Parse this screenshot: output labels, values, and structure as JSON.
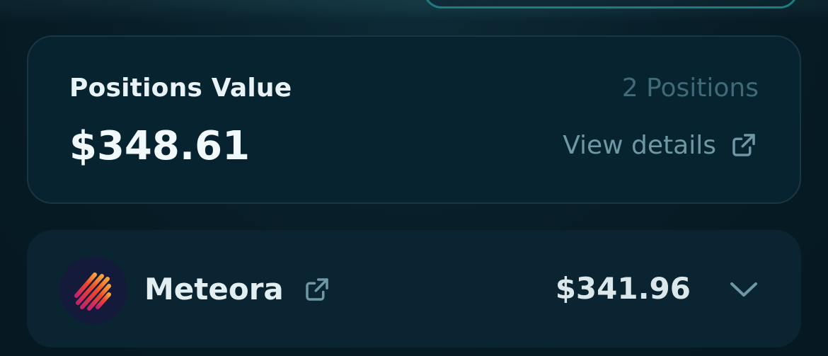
{
  "summary": {
    "label": "Positions Value",
    "amount": "$348.61",
    "positions_count": "2 Positions",
    "view_details_label": "View details"
  },
  "protocols": [
    {
      "name": "Meteora",
      "value": "$341.96",
      "logo_icon": "meteora-logo",
      "link_icon": "external-link-icon",
      "toggle_icon": "chevron-down-icon"
    }
  ],
  "colors": {
    "background": "#071c26",
    "card": "#082330",
    "accent_border": "#1f7b80",
    "muted_text": "#3f6a79",
    "link_text": "#6f98a7"
  }
}
